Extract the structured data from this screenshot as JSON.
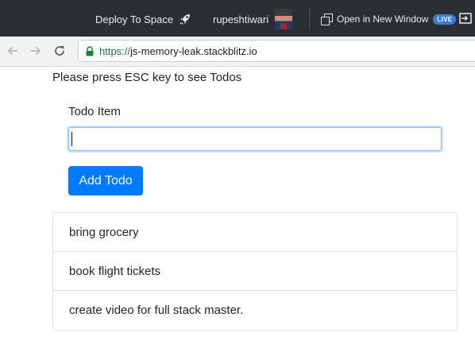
{
  "topbar": {
    "deploy_label": "Deploy To Space",
    "username": "rupeshtiwari",
    "open_window_label": "Open in New Window",
    "live_badge": "LIVE"
  },
  "browser": {
    "url_scheme": "https://",
    "url_host": "js-memory-leak.stackblitz.io"
  },
  "page": {
    "hint": "Please press ESC key to see Todos",
    "input_label": "Todo Item",
    "input_value": "",
    "add_button_label": "Add Todo",
    "todos": [
      "bring grocery",
      "book flight tickets",
      "create video for full stack master."
    ]
  },
  "colors": {
    "topbar_bg": "#2b2e33",
    "primary": "#007bff",
    "live_badge": "#3b7ddd",
    "secure_green": "#188038"
  },
  "icons": [
    "rocket-icon",
    "avatar",
    "open-window-icon",
    "exit-icon",
    "back-arrow-icon",
    "forward-arrow-icon",
    "reload-icon",
    "lock-icon"
  ]
}
